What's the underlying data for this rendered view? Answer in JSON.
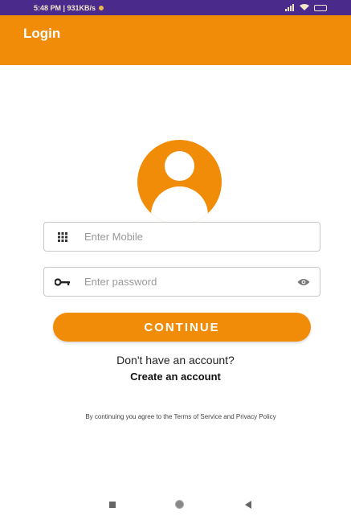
{
  "status_bar": {
    "time_info": "5:48 PM | 931KB/s",
    "icons": [
      "notification-icon",
      "signal-icon",
      "wifi-icon",
      "battery-icon"
    ]
  },
  "app_bar": {
    "title": "Login",
    "color": "#f08c08"
  },
  "avatar": {
    "icon": "user-avatar-icon",
    "color": "#f08c08"
  },
  "form": {
    "mobile": {
      "placeholder": "Enter Mobile",
      "value": "",
      "icon": "dialpad-icon"
    },
    "password": {
      "placeholder": "Enter password",
      "value": "",
      "icon": "key-icon",
      "toggle_icon": "eye-icon"
    },
    "continue_label": "CONTINUE"
  },
  "signup": {
    "prompt": "Don't have an account?",
    "link": "Create an account"
  },
  "terms": {
    "text": "By continuing you agree to the Terms of Service and Privacy Policy"
  },
  "nav_bar": {
    "icons": [
      "recents-icon",
      "home-icon",
      "back-icon"
    ]
  }
}
